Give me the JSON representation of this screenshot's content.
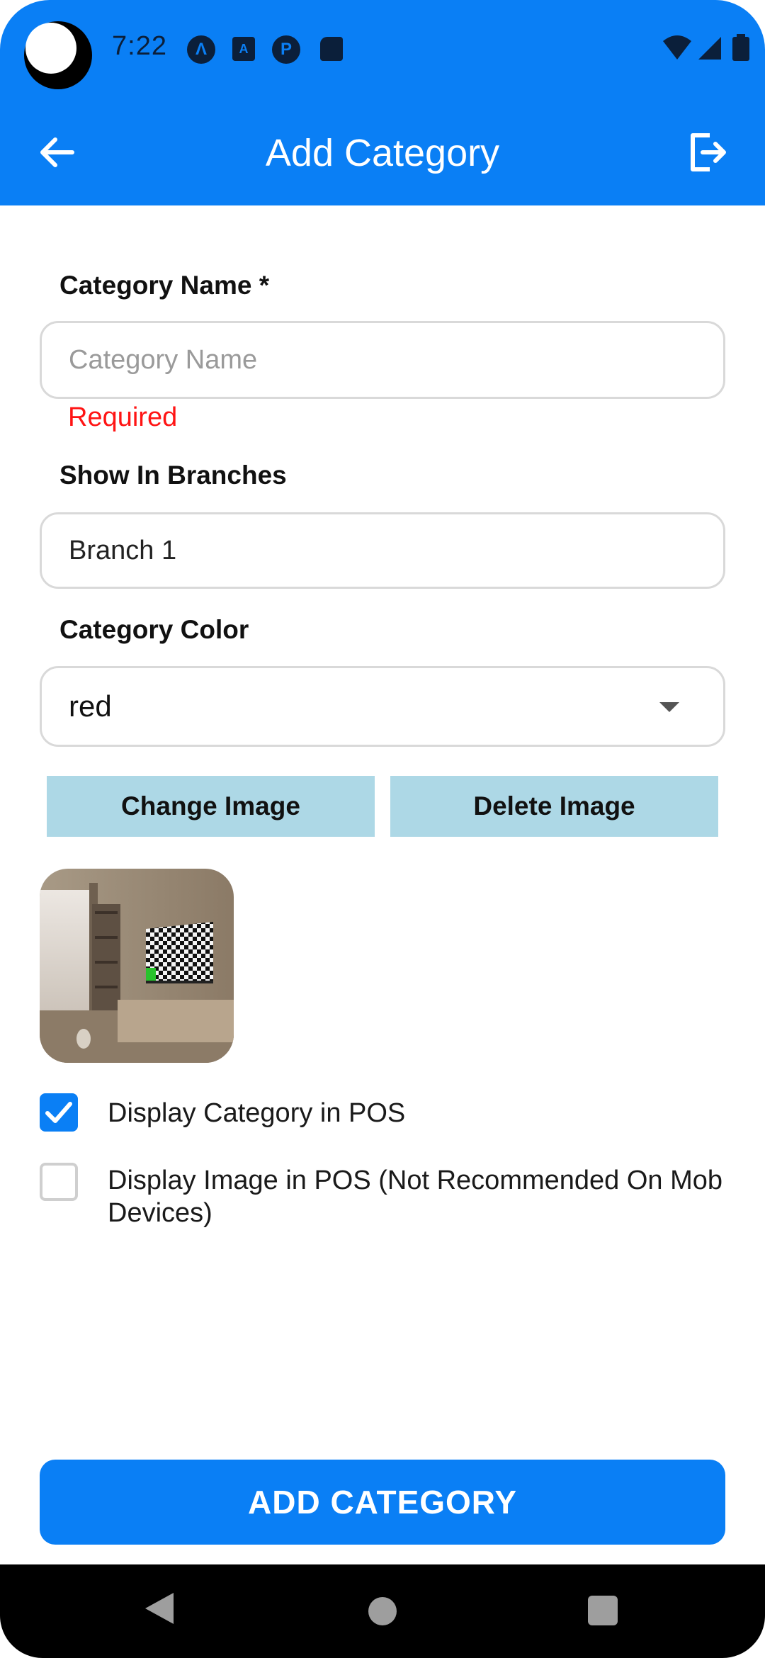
{
  "status_bar": {
    "time": "7:22",
    "icons": [
      "camera-cutout",
      "app-a-icon",
      "keyboard-a-icon",
      "app-p-icon",
      "sd-card-icon",
      "wifi-icon",
      "signal-icon",
      "battery-icon"
    ]
  },
  "app_bar": {
    "title": "Add Category",
    "back_icon": "arrow-left-icon",
    "logout_icon": "logout-icon",
    "background": "#0A7FF5"
  },
  "form": {
    "category_name": {
      "label": "Category Name *",
      "placeholder": "Category Name",
      "value": "",
      "error": "Required"
    },
    "show_in_branches": {
      "label": "Show In Branches",
      "value": "Branch 1"
    },
    "category_color": {
      "label": "Category Color",
      "value": "red"
    },
    "change_image_label": "Change Image",
    "delete_image_label": "Delete Image",
    "display_in_pos": {
      "label": "Display Category in POS",
      "checked": true
    },
    "display_image_in_pos": {
      "label": "Display Image in POS (Not Recommended On Mob Devices)",
      "checked": false
    }
  },
  "submit_label": "ADD CATEGORY",
  "colors": {
    "primary": "#0A7FF5",
    "secondary_button": "#ADD8E6",
    "error": "#FF1414"
  }
}
